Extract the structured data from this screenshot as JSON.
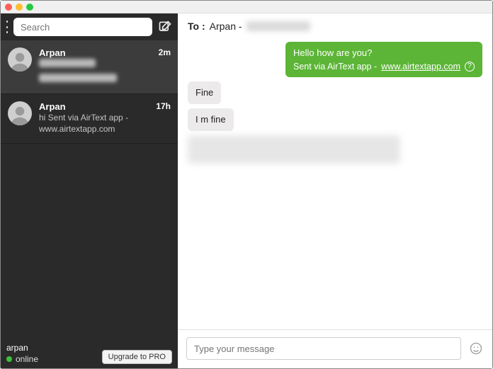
{
  "sidebar": {
    "search_placeholder": "Search",
    "conversations": [
      {
        "name": "Arpan",
        "preview": "",
        "time": "2m",
        "preview_blurred": true
      },
      {
        "name": "Arpan",
        "preview": "hi Sent via AirText app - www.airtextapp.com",
        "time": "17h",
        "preview_blurred": false
      }
    ],
    "user": {
      "name": "arpan",
      "status": "online"
    },
    "upgrade_label": "Upgrade to PRO"
  },
  "chat": {
    "to_label": "To :",
    "to_name": "Arpan -",
    "messages": [
      {
        "dir": "out",
        "text": "Hello how are you?",
        "sent_via_prefix": "Sent via AirText app - ",
        "link": "www.airtextapp.com"
      },
      {
        "dir": "in",
        "text": "Fine"
      },
      {
        "dir": "in",
        "text": "I m fine"
      },
      {
        "dir": "in",
        "blurred": true
      }
    ],
    "composer_placeholder": "Type your message"
  }
}
